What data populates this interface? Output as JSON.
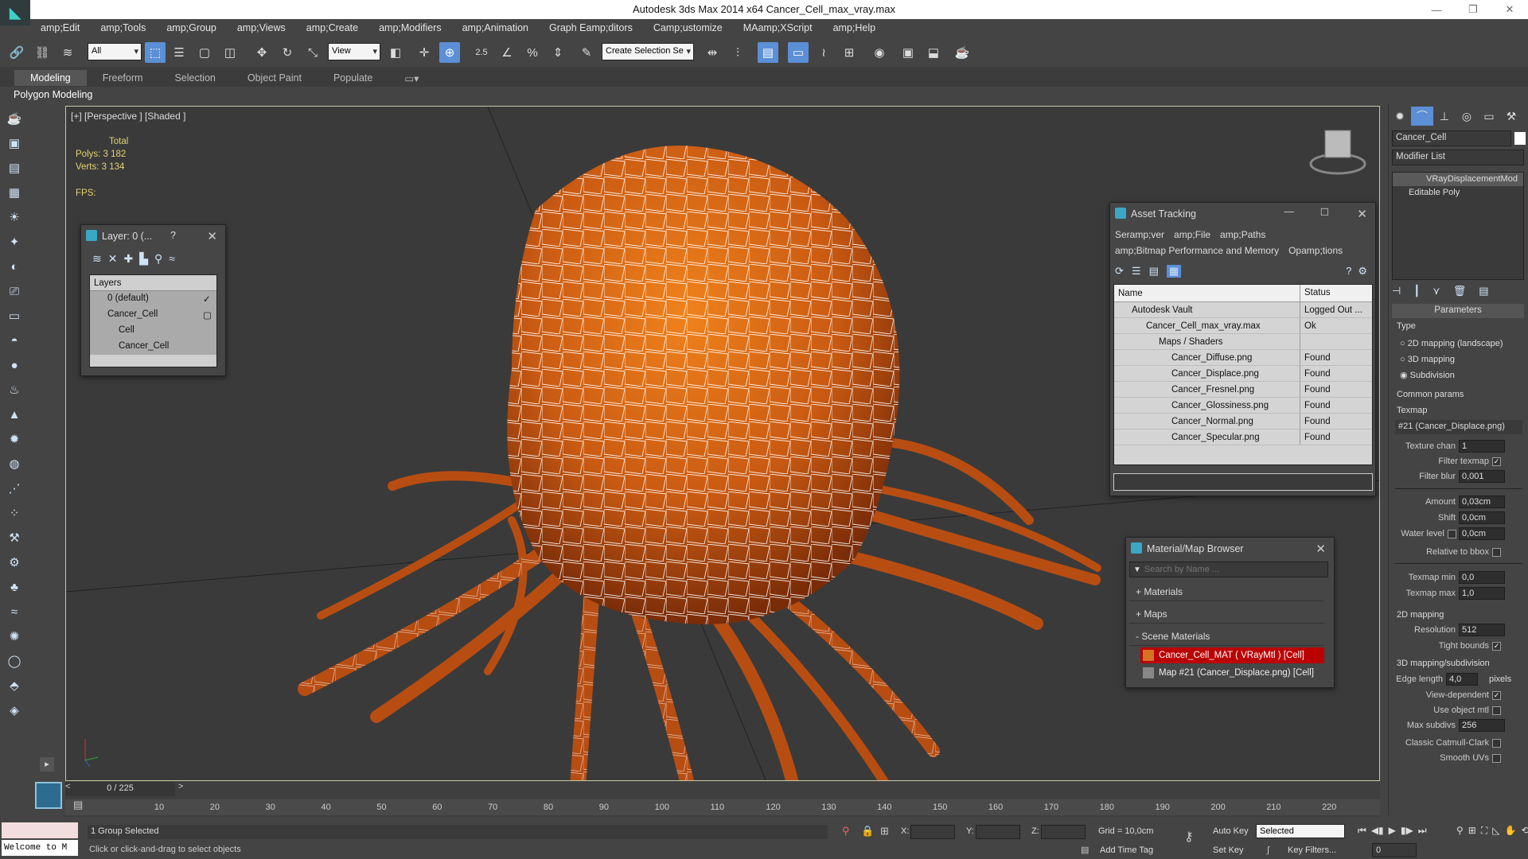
{
  "window": {
    "title": "Autodesk 3ds Max  2014 x64     Cancer_Cell_max_vray.max",
    "min": "—",
    "max": "❐",
    "close": "✕"
  },
  "menu": [
    "amp;Edit",
    "amp;Tools",
    "amp;Group",
    "amp;Views",
    "amp;Create",
    "amp;Modifiers",
    "amp;Animation",
    "Graph Eamp;ditors",
    "Camp;ustomize",
    "MAamp;XScript",
    "amp;Help"
  ],
  "toolbar": {
    "selection_filter": "All",
    "ref_coord": "View",
    "snap_angle": "2.5",
    "named_selection": "Create Selection Se"
  },
  "ribbon": {
    "tabs": [
      "Modeling",
      "Freeform",
      "Selection",
      "Object Paint",
      "Populate"
    ],
    "active": "Modeling",
    "sub": "Polygon Modeling"
  },
  "viewport": {
    "label": "[+] [Perspective ] [Shaded ]",
    "stats_total": "Total",
    "polys_label": "Polys:",
    "polys": "3 182",
    "verts_label": "Verts:",
    "verts": "3 134",
    "fps_label": "FPS:"
  },
  "layer_window": {
    "title": "Layer: 0 (...",
    "help": "?",
    "header": "Layers",
    "items": [
      {
        "label": "0 (default)",
        "indent": 1
      },
      {
        "label": "Cancer_Cell",
        "indent": 1
      },
      {
        "label": "Cell",
        "indent": 2
      },
      {
        "label": "Cancer_Cell",
        "indent": 2
      }
    ]
  },
  "asset_tracking": {
    "title": "Asset Tracking",
    "menu": [
      "Seramp;ver",
      "amp;File",
      "amp;Paths"
    ],
    "menu2": [
      "amp;Bitmap Performance and Memory",
      "Opamp;tions"
    ],
    "col_name": "Name",
    "col_status": "Status",
    "rows": [
      {
        "name": "Autodesk Vault",
        "status": "Logged Out ...",
        "indent": 1
      },
      {
        "name": "Cancer_Cell_max_vray.max",
        "status": "Ok",
        "indent": 2
      },
      {
        "name": "Maps / Shaders",
        "status": "",
        "indent": 3
      },
      {
        "name": "Cancer_Diffuse.png",
        "status": "Found",
        "indent": 4
      },
      {
        "name": "Cancer_Displace.png",
        "status": "Found",
        "indent": 4
      },
      {
        "name": "Cancer_Fresnel.png",
        "status": "Found",
        "indent": 4
      },
      {
        "name": "Cancer_Glossiness.png",
        "status": "Found",
        "indent": 4
      },
      {
        "name": "Cancer_Normal.png",
        "status": "Found",
        "indent": 4
      },
      {
        "name": "Cancer_Specular.png",
        "status": "Found",
        "indent": 4
      }
    ]
  },
  "material_browser": {
    "title": "Material/Map Browser",
    "search_placeholder": "Search by Name ...",
    "cat_materials": "+ Materials",
    "cat_maps": "+ Maps",
    "cat_scene": "- Scene Materials",
    "items": [
      "Cancer_Cell_MAT ( VRayMtl ) [Cell]",
      "Map #21 (Cancer_Displace.png) [Cell]"
    ]
  },
  "command_panel": {
    "object_name": "Cancer_Cell",
    "modifier_list": "Modifier List",
    "stack": [
      "VRayDisplacementMod",
      "Editable Poly"
    ],
    "params_title": "Parameters",
    "type_label": "Type",
    "type_options": [
      "2D mapping (landscape)",
      "3D mapping",
      "Subdivision"
    ],
    "common_label": "Common params",
    "texmap_label": "Texmap",
    "texmap": "#21 (Cancer_Displace.png)",
    "tex_chan_label": "Texture chan",
    "tex_chan": "1",
    "filter_texmap": "Filter texmap",
    "filter_blur_label": "Filter blur",
    "filter_blur": "0,001",
    "amount_label": "Amount",
    "amount": "0,03cm",
    "shift_label": "Shift",
    "shift": "0,0cm",
    "water_label": "Water level",
    "water": "0,0cm",
    "rel_bbox": "Relative to bbox",
    "texmin_label": "Texmap min",
    "texmin": "0,0",
    "texmax_label": "Texmap max",
    "texmax": "1,0",
    "map2d_label": "2D mapping",
    "resolution_label": "Resolution",
    "resolution": "512",
    "tight_bounds": "Tight bounds",
    "map3d_label": "3D mapping/subdivision",
    "edge_label": "Edge length",
    "edge": "4,0",
    "pixels": "pixels",
    "view_dep": "View-dependent",
    "use_obj_mtl": "Use object mtl",
    "max_subdivs_label": "Max subdivs",
    "max_subdivs": "256",
    "catmull": "Classic Catmull-Clark",
    "smooth_uvs": "Smooth UVs"
  },
  "timeline": {
    "frame": "0 / 225",
    "ticks": [
      "10",
      "20",
      "30",
      "40",
      "50",
      "60",
      "70",
      "80",
      "90",
      "100",
      "110",
      "120",
      "130",
      "140",
      "150",
      "160",
      "170",
      "180",
      "190",
      "200",
      "210",
      "220"
    ]
  },
  "status": {
    "maxscript": "Welcome to M",
    "selected": "1 Group Selected",
    "prompt": "Click or click-and-drag to select objects",
    "x_label": "X:",
    "y_label": "Y:",
    "z_label": "Z:",
    "grid": "Grid = 10,0cm",
    "auto_key": "Auto Key",
    "set_key": "Set Key",
    "key_mode": "Selected",
    "key_filters": "Key Filters...",
    "add_time_tag": "Add Time Tag",
    "frame_field": "0"
  }
}
